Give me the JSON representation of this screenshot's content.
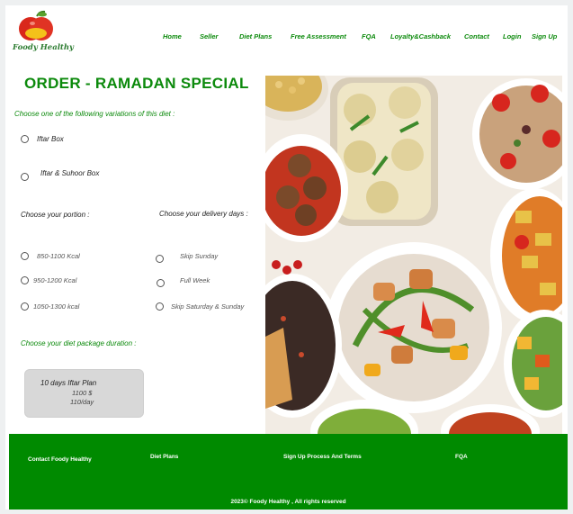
{
  "brand": {
    "name": "Foody Healthy"
  },
  "nav": {
    "items": [
      "Home",
      "Seller",
      "Diet Plans",
      "Free Assessment",
      "FQA",
      "Loyalty&Cashback",
      "Contact",
      "Login",
      "Sign Up"
    ]
  },
  "order": {
    "title": "ORDER - RAMADAN SPECIAL",
    "variation_prompt": "Choose one of the following variations of this diet :",
    "variations": [
      "Iftar Box",
      "Iftar & Suhoor Box"
    ],
    "portion_label": "Choose your portion :",
    "portions": [
      "850-1100 Kcal",
      "950-1200 Kcal",
      "1050-1300 kcal"
    ],
    "delivery_label": "Choose your delivery days :",
    "delivery_days": [
      "Skip Sunday",
      "Full Week",
      "Skip Saturday & Sunday"
    ],
    "duration_label": "Choose your diet package duration :",
    "plan": {
      "name": "10 days Iftar Plan",
      "price": "1100 $",
      "per_day": "110/day"
    }
  },
  "footer": {
    "links": [
      "Contact Foody Healthy",
      "Diet Plans",
      "Sign Up Process And Terms",
      "FQA"
    ],
    "copyright": "2023© Foody Healthy , All rights reserved"
  },
  "colors": {
    "accent": "#0c8a0c",
    "footer_bg": "#008a00"
  },
  "image": {
    "icon": "food-bowls-photo"
  }
}
